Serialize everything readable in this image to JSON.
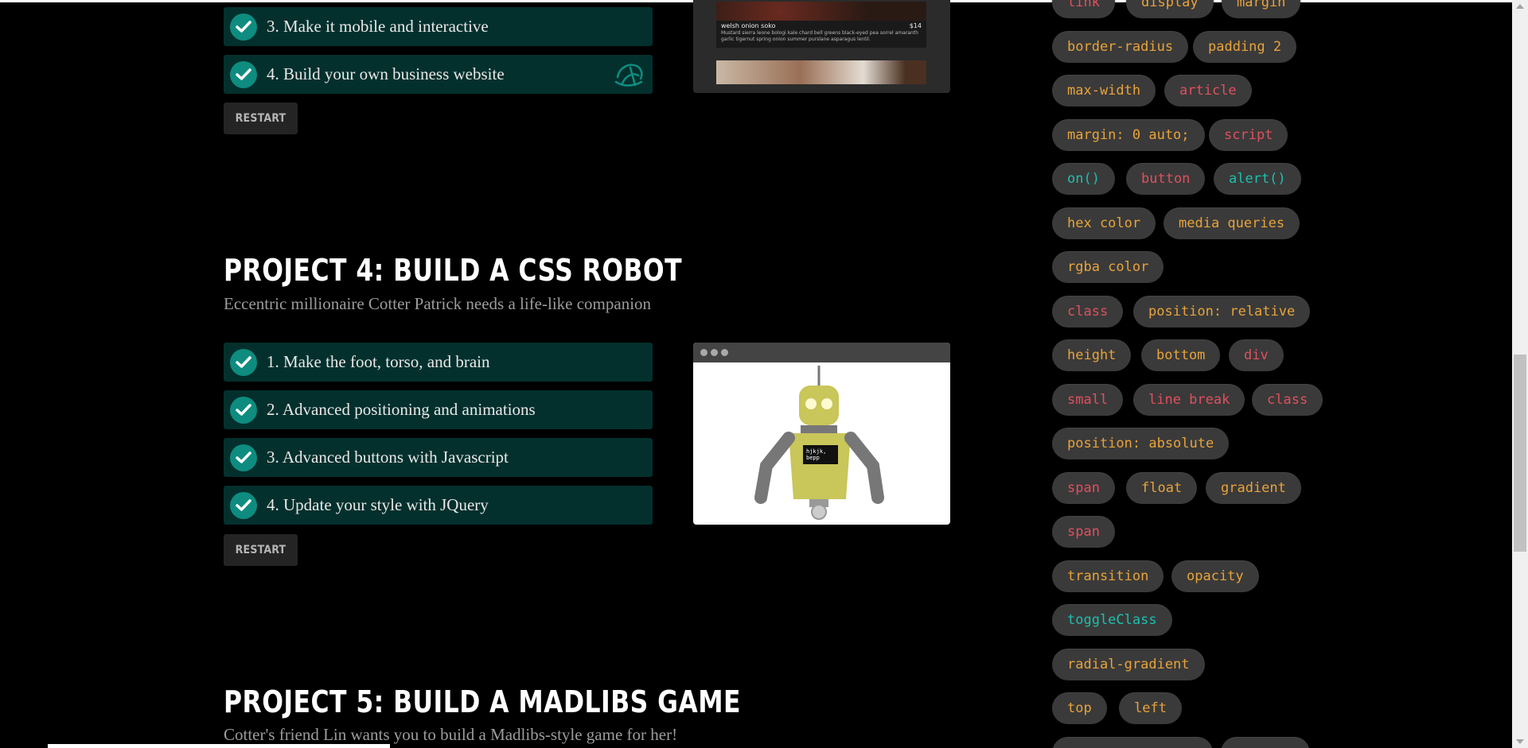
{
  "project3": {
    "tasks": [
      {
        "label": "3. Make it mobile and interactive",
        "checked": true
      },
      {
        "label": "4. Build your own business website",
        "checked": true
      }
    ],
    "restart_label": "RESTART",
    "preview": {
      "item_name": "welsh onion soko",
      "item_price": "$14",
      "item_desc": "Mustard sierra leone bologi kale chard bell greens black-eyed pea sorrel amaranth garlic tigernut spring onion summer purslane asparagus lentil."
    }
  },
  "project4": {
    "title": "PROJECT 4: BUILD A CSS ROBOT",
    "subtitle": "Eccentric millionaire Cotter Patrick needs a life-like companion",
    "tasks": [
      {
        "label": "1. Make the foot, torso, and brain",
        "checked": true
      },
      {
        "label": "2. Advanced positioning and animations",
        "checked": true
      },
      {
        "label": "3. Advanced buttons with Javascript",
        "checked": true
      },
      {
        "label": "4. Update your style with JQuery",
        "checked": true
      }
    ],
    "restart_label": "RESTART",
    "robot_screen_text": "hjkjk,\nbepp"
  },
  "project5": {
    "title": "PROJECT 5: BUILD A MADLIBS GAME",
    "subtitle": "Cotter's friend Lin wants you to build a Madlibs-style game for her!"
  },
  "tags": [
    {
      "label": "link",
      "color": "#e0505e"
    },
    {
      "label": "display",
      "color": "#e8a33a"
    },
    {
      "label": "margin",
      "color": "#e8a33a"
    },
    {
      "label": "border-radius",
      "color": "#e8a33a"
    },
    {
      "label": "padding 2",
      "color": "#e8a33a"
    },
    {
      "label": "max-width",
      "color": "#e8a33a"
    },
    {
      "label": "article",
      "color": "#e0505e"
    },
    {
      "label": "margin: 0 auto;",
      "color": "#e8a33a"
    },
    {
      "label": "script",
      "color": "#e0505e"
    },
    {
      "label": "on()",
      "color": "#1fbfae"
    },
    {
      "label": "button",
      "color": "#e0505e"
    },
    {
      "label": "alert()",
      "color": "#1fbfae"
    },
    {
      "label": "hex color",
      "color": "#e8a33a"
    },
    {
      "label": "media queries",
      "color": "#e8a33a"
    },
    {
      "label": "rgba color",
      "color": "#e8a33a"
    },
    {
      "label": "class",
      "color": "#e0505e"
    },
    {
      "label": "position: relative",
      "color": "#e8a33a"
    },
    {
      "label": "height",
      "color": "#e8a33a"
    },
    {
      "label": "bottom",
      "color": "#e8a33a"
    },
    {
      "label": "div",
      "color": "#e0505e"
    },
    {
      "label": "small",
      "color": "#e0505e"
    },
    {
      "label": "line break",
      "color": "#e0505e"
    },
    {
      "label": "class",
      "color": "#e0505e"
    },
    {
      "label": "position: absolute",
      "color": "#e8a33a"
    },
    {
      "label": "span",
      "color": "#e0505e"
    },
    {
      "label": "float",
      "color": "#e8a33a"
    },
    {
      "label": "gradient",
      "color": "#e8a33a"
    },
    {
      "label": "span",
      "color": "#e0505e"
    },
    {
      "label": "transition",
      "color": "#e8a33a"
    },
    {
      "label": "opacity",
      "color": "#e8a33a"
    },
    {
      "label": "toggleClass",
      "color": "#1fbfae"
    },
    {
      "label": "radial-gradient",
      "color": "#e8a33a"
    },
    {
      "label": "top",
      "color": "#e8a33a"
    },
    {
      "label": "left",
      "color": "#e8a33a"
    }
  ]
}
